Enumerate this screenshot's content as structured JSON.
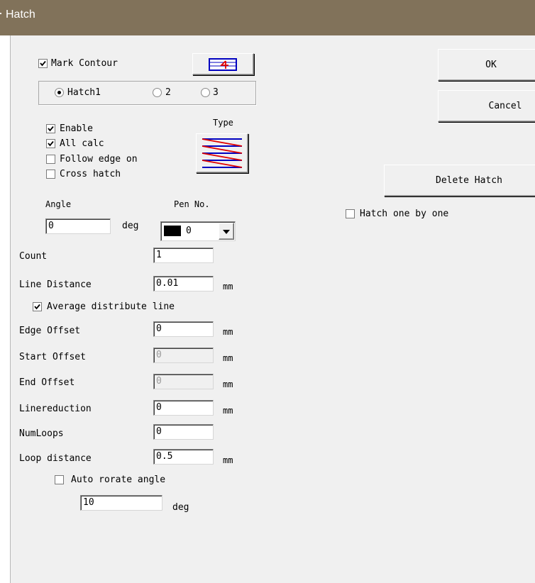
{
  "window": {
    "title": "Hatch"
  },
  "buttons": {
    "ok": "OK",
    "cancel": "Cancel",
    "delete_hatch": "Delete Hatch"
  },
  "mark_contour": {
    "label": "Mark Contour",
    "checked": true
  },
  "hatch_select": {
    "options": [
      "Hatch1",
      "2",
      "3"
    ],
    "selected": "Hatch1"
  },
  "options": {
    "enable": {
      "label": "Enable",
      "checked": true
    },
    "all_calc": {
      "label": "All calc",
      "checked": true
    },
    "follow_edge": {
      "label": "Follow edge on",
      "checked": false
    },
    "cross_hatch": {
      "label": "Cross hatch",
      "checked": false
    }
  },
  "type_label": "Type",
  "angle": {
    "label": "Angle",
    "value": "0",
    "unit": "deg"
  },
  "pen": {
    "label": "Pen No.",
    "value": "0",
    "color": "#000000"
  },
  "hatch_one_by_one": {
    "label": "Hatch one by one",
    "checked": false
  },
  "fields": {
    "count": {
      "label": "Count",
      "value": "1"
    },
    "line_distance": {
      "label": "Line Distance",
      "value": "0.01",
      "unit": "mm"
    },
    "average": {
      "label": "Average distribute line",
      "checked": true
    },
    "edge_offset": {
      "label": "Edge Offset",
      "value": "0",
      "unit": "mm"
    },
    "start_offset": {
      "label": "Start Offset",
      "value": "0",
      "unit": "mm",
      "disabled": true
    },
    "end_offset": {
      "label": "End Offset",
      "value": "0",
      "unit": "mm",
      "disabled": true
    },
    "linereduction": {
      "label": "Linereduction",
      "value": "0",
      "unit": "mm"
    },
    "numloops": {
      "label": "NumLoops",
      "value": "0"
    },
    "loop_distance": {
      "label": "Loop distance",
      "value": "0.5",
      "unit": "mm"
    },
    "auto_rotate": {
      "label": "Auto rorate angle",
      "checked": false
    },
    "rotate_angle": {
      "value": "10",
      "unit": "deg"
    }
  }
}
